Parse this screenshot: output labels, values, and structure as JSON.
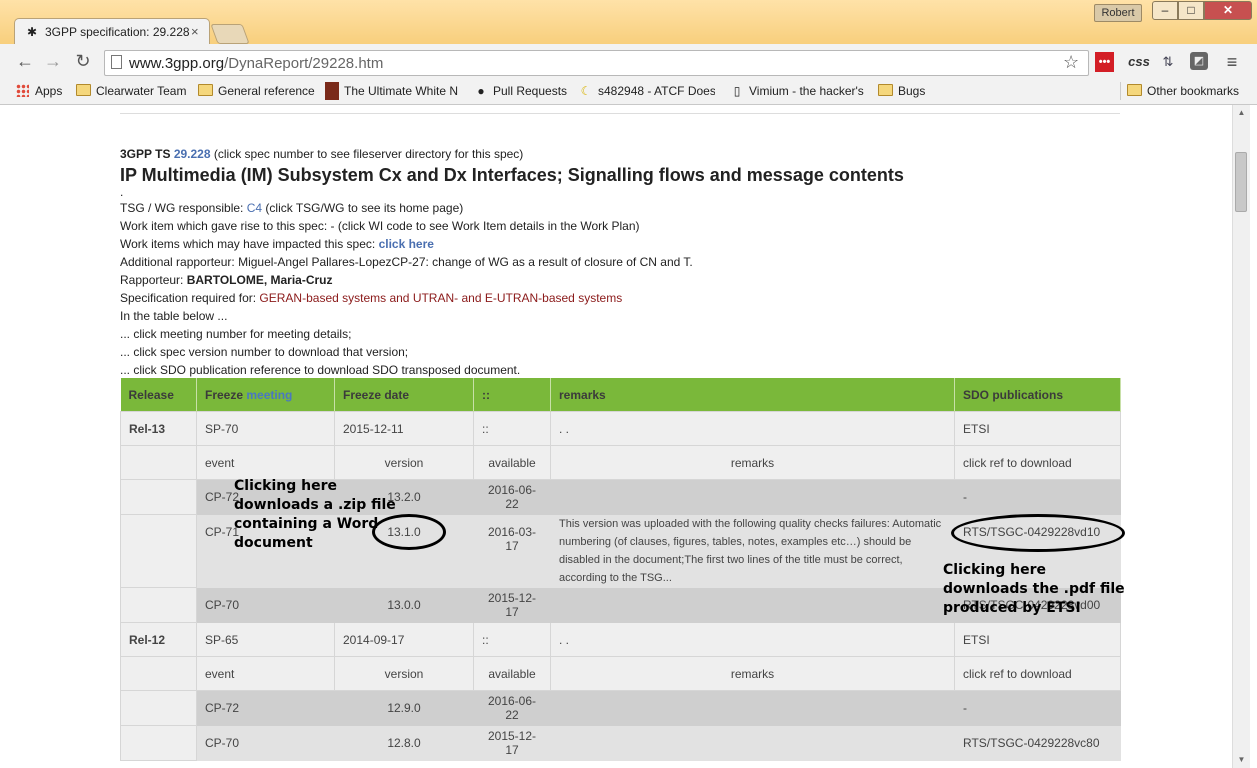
{
  "browser": {
    "tab_title": "3GPP specification: 29.228",
    "tab_icon": "spider-logo-icon",
    "close_glyph": "×",
    "user": "Robert",
    "url_host": "www.3gpp.org",
    "url_path": "/DynaReport/29228.htm",
    "ext_css": "css",
    "bookmarks": [
      "Apps",
      "Clearwater Team",
      "General reference",
      "The Ultimate White N",
      "Pull Requests",
      "s482948 - ATCF Does",
      "Vimium - the hacker's",
      "Bugs"
    ],
    "other_bookmarks": "Other bookmarks"
  },
  "page": {
    "spec_prefix": "3GPP TS",
    "spec_number": "29.228",
    "spec_hint": "(click spec number to see fileserver directory for this spec)",
    "title": "IP Multimedia (IM) Subsystem Cx and Dx Interfaces; Signalling flows and message contents",
    "dot": ".",
    "tsg_label": "TSG / WG responsible:",
    "tsg_value": "C4",
    "tsg_hint": "(click TSG/WG to see its home page)",
    "work_item": "Work item which gave rise to this spec: - (click WI code to see Work Item details in the Work Plan)",
    "impacted_label": "Work items which may have impacted this spec:",
    "impacted_link": "click here",
    "additional": "Additional rapporteur: Miguel-Angel Pallares-LopezCP-27: change of WG as a result of closure of CN and T.",
    "rapporteur_label": "Rapporteur:",
    "rapporteur_name": "BARTOLOME, Maria-Cruz",
    "required_label": "Specification required for:",
    "required_value": "GERAN-based systems and UTRAN- and E-UTRAN-based systems",
    "table_below": "In the table below ...",
    "hint1": "... click meeting number for meeting details;",
    "hint2": "... click spec version number to download that version;",
    "hint3": "... click SDO publication reference to download SDO transposed document."
  },
  "table": {
    "headers": {
      "release": "Release",
      "freeze": "Freeze",
      "meeting": "meeting",
      "freeze_date": "Freeze date",
      "colons": "::",
      "remarks": "remarks",
      "sdo": "SDO publications"
    },
    "sub_headers": {
      "event": "event",
      "version": "version",
      "available": "available",
      "remarks": "remarks",
      "download": "click ref to download"
    },
    "rel13": {
      "release": "Rel-13",
      "meeting": "SP-70",
      "date": "2015-12-11",
      "colons": "::",
      "remarks": ". .",
      "sdo": "ETSI",
      "versions": [
        {
          "event": "CP-72",
          "version": "13.2.0",
          "available": "2016-06-22",
          "remarks": "",
          "sdo": "-"
        },
        {
          "event": "CP-71",
          "version": "13.1.0",
          "available": "2016-03-17",
          "remarks": "This version was uploaded with the following quality checks failures: Automatic numbering (of clauses, figures, tables, notes, examples etc…) should be disabled in the document;The first two lines of the title must be correct, according to the TSG...",
          "sdo": "RTS/TSGC-0429228vd10"
        },
        {
          "event": "CP-70",
          "version": "13.0.0",
          "available": "2015-12-17",
          "remarks": "",
          "sdo": "RTS/TSGC-0429228vd00"
        }
      ]
    },
    "rel12": {
      "release": "Rel-12",
      "meeting": "SP-65",
      "date": "2014-09-17",
      "colons": "::",
      "remarks": ". .",
      "sdo": "ETSI",
      "versions": [
        {
          "event": "CP-72",
          "version": "12.9.0",
          "available": "2016-06-22",
          "remarks": "",
          "sdo": "-"
        },
        {
          "event": "CP-70",
          "version": "12.8.0",
          "available": "2015-12-17",
          "remarks": "",
          "sdo": "RTS/TSGC-0429228vc80"
        }
      ]
    }
  },
  "annotations": {
    "zip_note": [
      "Clicking here",
      "downloads a .zip file",
      "containing a Word",
      "document"
    ],
    "pdf_note": [
      "Clicking here",
      "downloads the .pdf file",
      "produced by ETSI"
    ]
  },
  "colors": {
    "header_green": "#7ab83a",
    "link_blue": "#4a6fb0",
    "maroon": "#8b1a1a",
    "window_title_bar": "#f8cf7d",
    "close_red": "#c75050"
  }
}
